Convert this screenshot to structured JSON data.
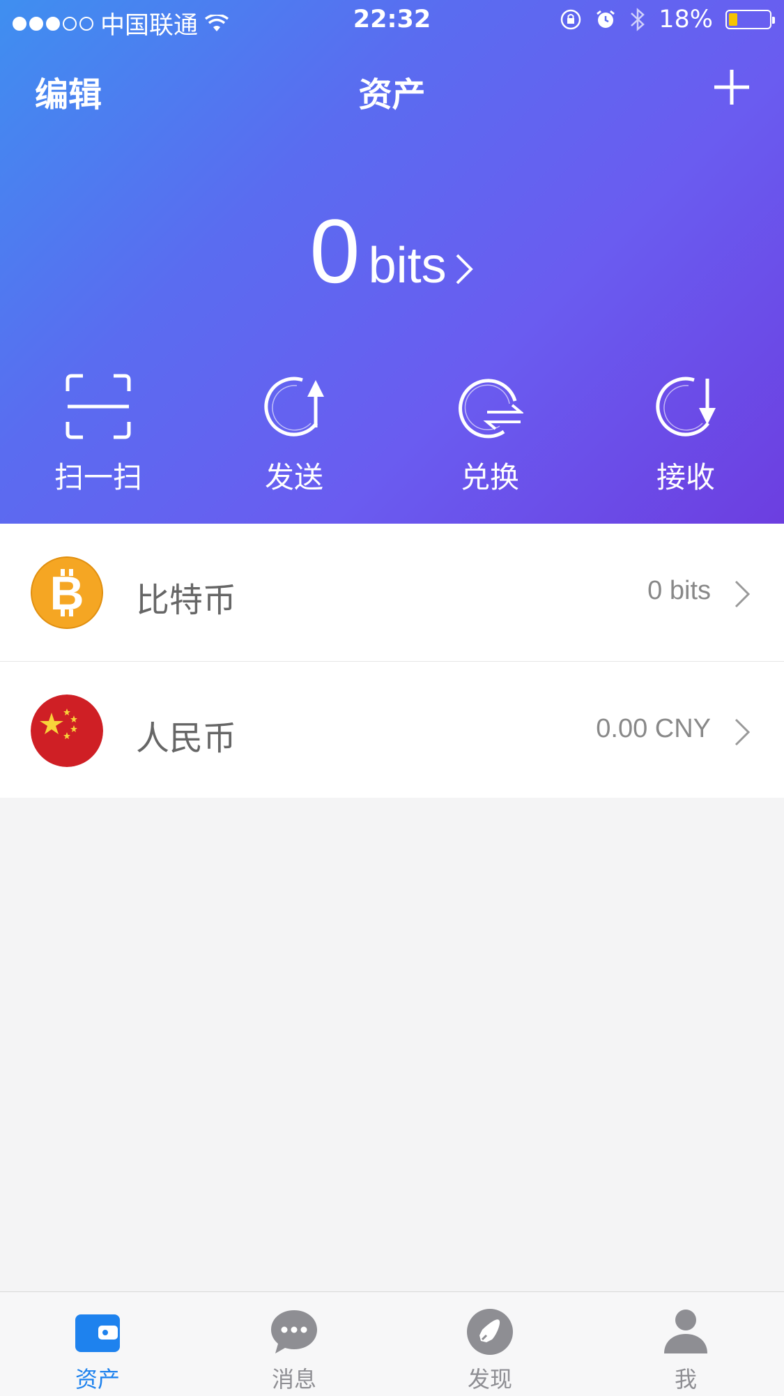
{
  "status_bar": {
    "carrier": "中国联通",
    "time": "22:32",
    "battery": "18%",
    "signal_bars_filled": 3,
    "signal_bars_total": 5
  },
  "nav": {
    "edit_label": "编辑",
    "title": "资产"
  },
  "balance": {
    "amount": "0",
    "unit": "bits"
  },
  "actions": [
    {
      "label": "扫一扫",
      "icon": "scan-icon"
    },
    {
      "label": "发送",
      "icon": "send-icon"
    },
    {
      "label": "兑换",
      "icon": "exchange-icon"
    },
    {
      "label": "接收",
      "icon": "receive-icon"
    }
  ],
  "assets": [
    {
      "name": "比特币",
      "value": "0 bits",
      "icon": "bitcoin-icon",
      "color": "#f5a623"
    },
    {
      "name": "人民币",
      "value": "0.00 CNY",
      "icon": "china-flag-icon",
      "color": "#cf1f25"
    }
  ],
  "tabs": [
    {
      "label": "资产",
      "icon": "wallet-icon",
      "active": true
    },
    {
      "label": "消息",
      "icon": "message-icon",
      "active": false
    },
    {
      "label": "发现",
      "icon": "compass-icon",
      "active": false
    },
    {
      "label": "我",
      "icon": "person-icon",
      "active": false
    }
  ],
  "colors": {
    "accent": "#1e82ee",
    "gradient_start": "#3f8ff0",
    "gradient_end": "#6c3ee0",
    "inactive_tab": "#8e8e93"
  }
}
